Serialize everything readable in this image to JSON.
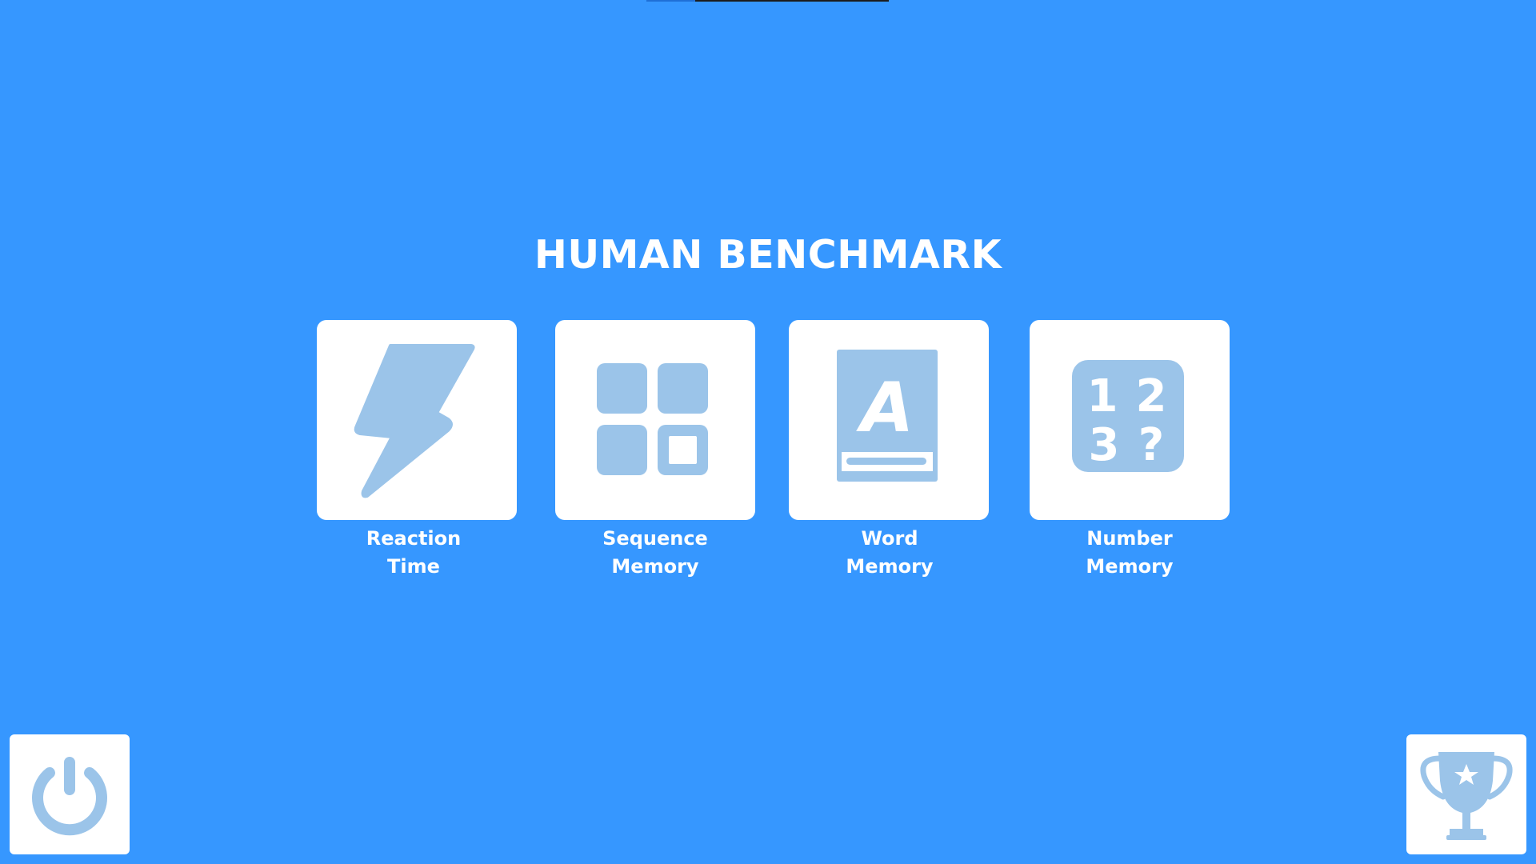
{
  "app": {
    "title": "HUMAN BENCHMARK"
  },
  "colors": {
    "background": "#3697ff",
    "tile": "#ffffff",
    "icon": "#9bc4e9",
    "text": "#ffffff"
  },
  "tests": [
    {
      "line1": "Reaction",
      "line2": "Time",
      "icon": "lightning-bolt-icon"
    },
    {
      "line1": "Sequence",
      "line2": "Memory",
      "icon": "grid-squares-icon"
    },
    {
      "line1": "Word",
      "line2": "Memory",
      "icon": "book-letter-a-icon"
    },
    {
      "line1": "Number",
      "line2": "Memory",
      "icon": "numbers-question-icon"
    }
  ],
  "corner_buttons": {
    "power": {
      "icon": "power-icon"
    },
    "leaderboard": {
      "icon": "trophy-icon"
    }
  },
  "number_icon": {
    "glyph1": "1",
    "glyph2": "2",
    "glyph3": "3",
    "glyph4": "?"
  },
  "word_icon": {
    "glyph": "A"
  },
  "progress": {
    "fraction": 0.2
  }
}
